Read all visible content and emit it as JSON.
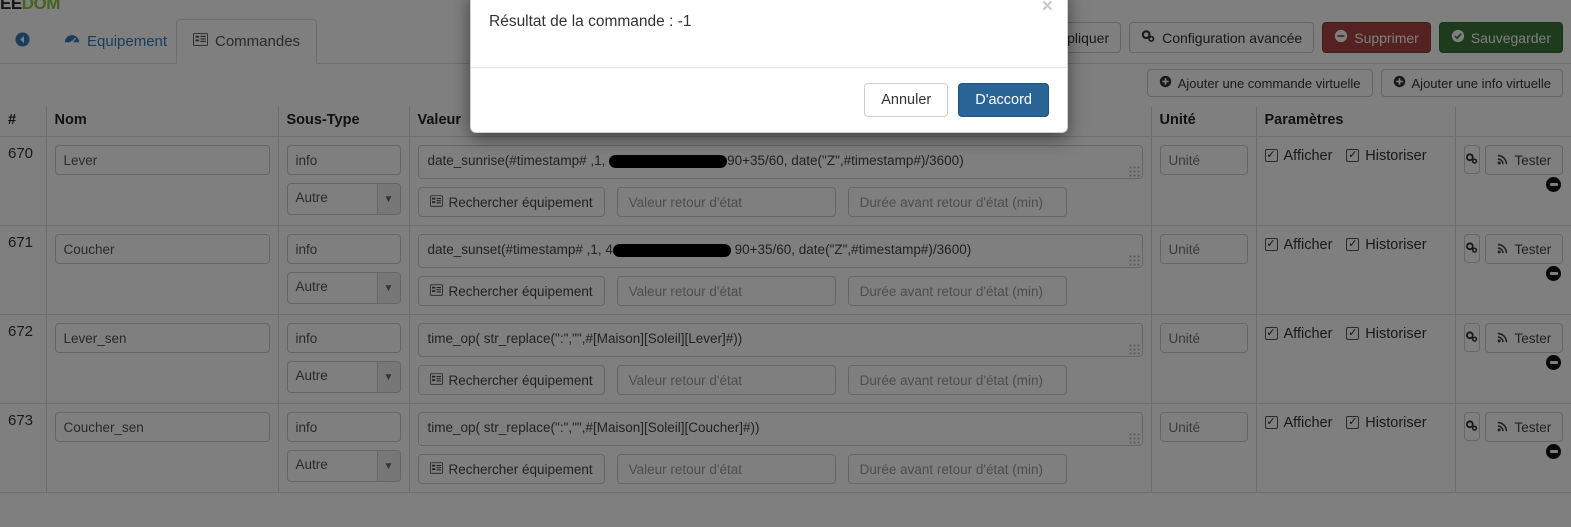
{
  "brand": {
    "part_dark": "EE",
    "part_green": "DOM"
  },
  "tabs": [
    {
      "name": "back",
      "icon": "arrow-circle-left-icon",
      "label": ""
    },
    {
      "name": "equipement",
      "icon": "dashboard-icon",
      "label": "Equipement"
    },
    {
      "name": "commandes",
      "icon": "list-icon",
      "label": "Commandes"
    }
  ],
  "toolbar": {
    "apply_label": "Appliquer",
    "advanced_label": "Configuration avancée",
    "delete_label": "Supprimer",
    "save_label": "Sauvegarder"
  },
  "subtoolbar": {
    "add_virtual_command": "Ajouter une commande virtuelle",
    "add_virtual_info": "Ajouter une info virtuelle"
  },
  "table": {
    "headers": [
      "#",
      "Nom",
      "Sous-Type",
      "Valeur",
      "Unité",
      "Paramètres",
      ""
    ],
    "placeholders": {
      "unit": "Unité",
      "search_equipment": "Rechercher équipement",
      "return_value": "Valeur retour d'état",
      "return_duration": "Durée avant retour d'état (min)"
    },
    "labels": {
      "show": "Afficher",
      "historize": "Historiser",
      "test": "Tester"
    },
    "rows": [
      {
        "id": "670",
        "name": "Lever",
        "subtype": "info",
        "type_select": "Autre",
        "value_prefix": "date_sunrise(#timestamp# ,1, ",
        "value_suffix": "90+35/60, date(\"Z\",#timestamp#)/3600)",
        "redacted": true,
        "show": true,
        "historize": true
      },
      {
        "id": "671",
        "name": "Coucher",
        "subtype": "info",
        "type_select": "Autre",
        "value_prefix": "date_sunset(#timestamp# ,1, 4",
        "value_suffix": " 90+35/60, date(\"Z\",#timestamp#)/3600)",
        "redacted": true,
        "show": true,
        "historize": true
      },
      {
        "id": "672",
        "name": "Lever_sen",
        "subtype": "info",
        "type_select": "Autre",
        "value_prefix": "time_op( str_replace(\":\",\"\",#[Maison][Soleil][Lever]#))",
        "value_suffix": "",
        "redacted": false,
        "show": true,
        "historize": true
      },
      {
        "id": "673",
        "name": "Coucher_sen",
        "subtype": "info",
        "type_select": "Autre",
        "value_prefix": "time_op( str_replace(\":\",\"\",#[Maison][Soleil][Coucher]#))",
        "value_suffix": "",
        "redacted": false,
        "show": true,
        "historize": true
      }
    ]
  },
  "modal": {
    "title": "Résultat de la commande : -1",
    "close": "×",
    "cancel_label": "Annuler",
    "ok_label": "D'accord"
  },
  "colors": {
    "link": "#337ab7",
    "danger": "#a94442",
    "success": "#3c763d",
    "primary": "#2a6496",
    "brand_green": "#8bc53f"
  }
}
